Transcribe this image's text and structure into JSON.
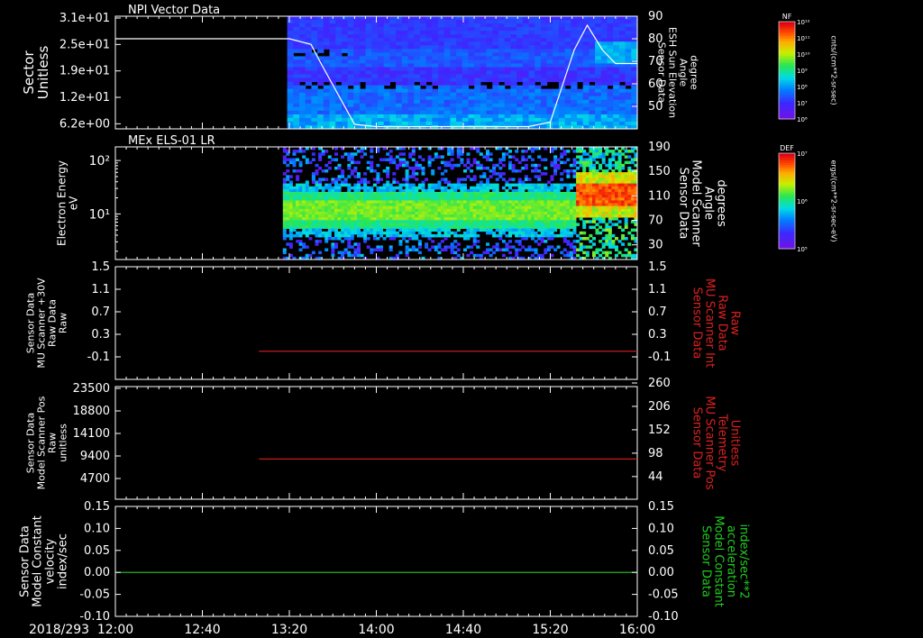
{
  "date_label": "2018/293",
  "time_axis": {
    "range": [
      "12:00",
      "16:00"
    ],
    "major_ticks": [
      "12:00",
      "12:40",
      "13:20",
      "14:00",
      "14:40",
      "15:20",
      "16:00"
    ]
  },
  "chart_data": [
    {
      "type": "heatmap",
      "title": "NPI Vector Data",
      "ylabel": [
        "Sector",
        "Unitless"
      ],
      "yticks": [
        "3.1e+01",
        "2.5e+01",
        "1.9e+01",
        "1.2e+01",
        "6.2e+00"
      ],
      "ylim": [
        0,
        31
      ],
      "data_start": "13:19",
      "colorbar": {
        "label": "NF",
        "unit": "cnts/(cm**2-sr-sec)",
        "ticks": [
          "10¹²",
          "10¹¹",
          "10¹⁰",
          "10⁹",
          "10⁸",
          "10⁷",
          "10⁶"
        ]
      },
      "overlay": {
        "name": [
          "Sensor Data",
          "ESH Sun Elevation",
          "Angle",
          "degree"
        ],
        "color": "#ffffff",
        "ylim": [
          40,
          90
        ],
        "yticks": [
          "90",
          "80",
          "70",
          "60",
          "50"
        ],
        "x": [
          "12:00",
          "13:20",
          "13:30",
          "13:34",
          "13:50",
          "14:00",
          "15:00",
          "15:10",
          "15:20",
          "15:31",
          "15:37",
          "15:44",
          "15:50",
          "16:00"
        ],
        "y": [
          80,
          80,
          77.5,
          70,
          42,
          41,
          41,
          41,
          43,
          75,
          86,
          75,
          69,
          69
        ]
      }
    },
    {
      "type": "heatmap",
      "title": "MEx ELS-01 LR",
      "ylabel": [
        "Electron Energy",
        "eV"
      ],
      "yticks": [
        "10²",
        "10¹"
      ],
      "ylim": [
        1.4,
        180
      ],
      "log": true,
      "data_start": "13:17",
      "colorbar": {
        "label": "DEF",
        "unit": "ergs/(cm**2-sr-sec-eV)",
        "ticks": [
          "10⁷",
          "10⁶",
          "10⁵"
        ]
      },
      "overlay": {
        "name": [
          "Sensor Data",
          "Model Scanner",
          "Angle",
          "degrees"
        ],
        "color": "#ffffff",
        "ylim": [
          6,
          190
        ],
        "yticks": [
          "190",
          "150",
          "110",
          "70",
          "30"
        ],
        "x": [
          "12:00",
          "16:00"
        ],
        "y": [
          6,
          6
        ]
      }
    },
    {
      "type": "line",
      "ylabel": [
        "Sensor Data",
        "MU Scanner +30V",
        "Raw Data",
        "Raw"
      ],
      "yticks": [
        "1.5",
        "1.1",
        "0.7",
        "0.3",
        "-0.1"
      ],
      "ylim": [
        -0.5,
        1.5
      ],
      "series": [
        {
          "name": [
            "Sensor Data",
            "MU Scanner Int",
            "Raw Data",
            "Raw"
          ],
          "color": "#dd2020",
          "ylim": [
            -0.5,
            1.5
          ],
          "yticks": [
            "1.5",
            "1.1",
            "0.7",
            "0.3",
            "-0.1"
          ],
          "x": [
            "13:06",
            "16:00"
          ],
          "y": [
            0,
            0
          ]
        }
      ]
    },
    {
      "type": "line",
      "ylabel": [
        "Sensor Data",
        "Model Scanner Pos",
        "Raw",
        "unitless"
      ],
      "yticks": [
        "23500",
        "18800",
        "14100",
        "9400",
        "4700"
      ],
      "ylim": [
        0,
        23500
      ],
      "series": [
        {
          "name": [
            "Sensor Data",
            "MU Scanner Pos",
            "Telemetry",
            "Unitless"
          ],
          "color": "#dd2020",
          "ylim": [
            0,
            260
          ],
          "yticks": [
            "260",
            "206",
            "152",
            "98",
            "44"
          ],
          "x": [
            "13:06",
            "16:00"
          ],
          "y": [
            8400,
            8400
          ]
        }
      ]
    },
    {
      "type": "line",
      "ylabel": [
        "Sensor Data",
        "Model Constant",
        "velocity",
        "index/sec"
      ],
      "yticks": [
        "0.15",
        "0.10",
        "0.05",
        "0.00",
        "-0.05",
        "-0.10"
      ],
      "ylim": [
        -0.1,
        0.15
      ],
      "series": [
        {
          "name": [
            "Sensor Data",
            "Model Constant",
            "acceleration",
            "index/sec**2"
          ],
          "color": "#22cc22",
          "ylim": [
            -0.1,
            0.15
          ],
          "yticks": [
            "0.15",
            "0.10",
            "0.05",
            "0.00",
            "-0.05",
            "-0.10"
          ],
          "x": [
            "12:00",
            "16:00"
          ],
          "y": [
            0,
            0
          ]
        }
      ]
    }
  ]
}
